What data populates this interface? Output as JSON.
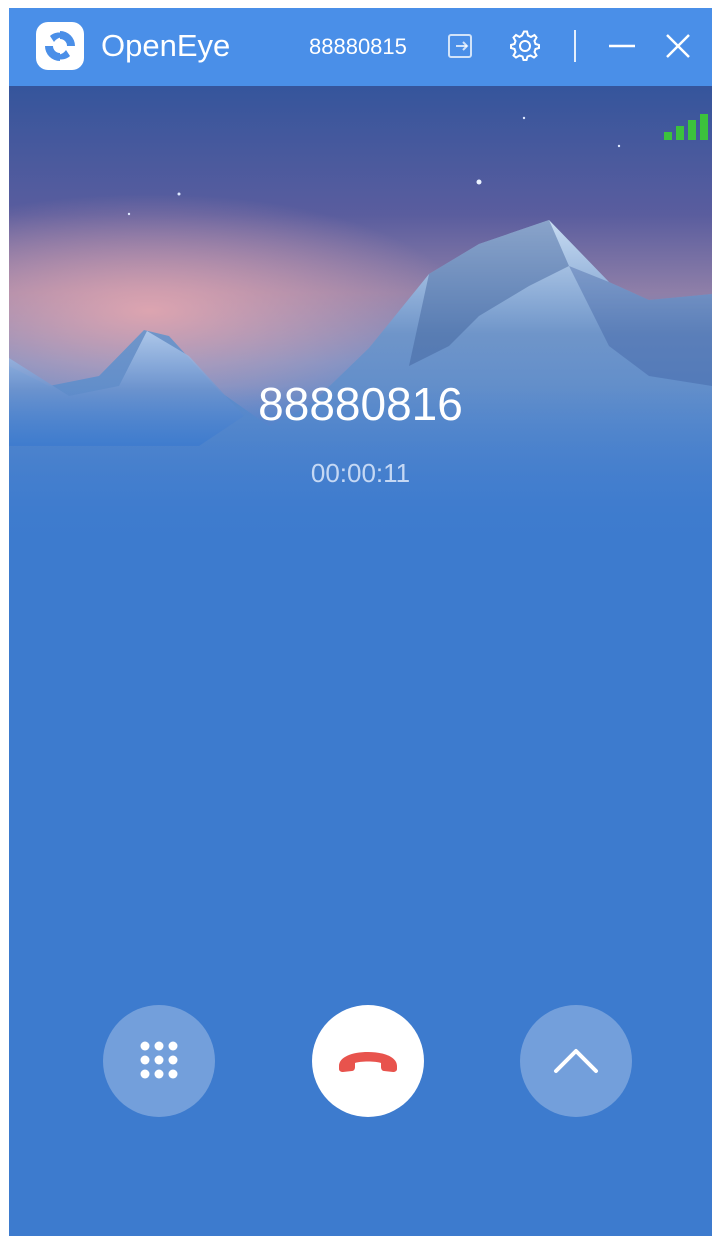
{
  "app": {
    "name": "OpenEye",
    "account_number": "88880815"
  },
  "titlebar": {
    "icons": [
      "logout-icon",
      "gear-icon",
      "minimize-icon",
      "close-icon"
    ]
  },
  "call": {
    "callee_number": "88880816",
    "duration": "00:00:11",
    "signal_strength_bars": 4
  },
  "controls": {
    "icons": [
      "keypad-icon",
      "hangup-icon",
      "chevron-up-icon"
    ]
  },
  "colors": {
    "titlebar_bg": "#4a8fe8",
    "window_bg": "#3d7bce",
    "signal_green": "#3cc23c",
    "hangup_red": "#e8534d"
  }
}
